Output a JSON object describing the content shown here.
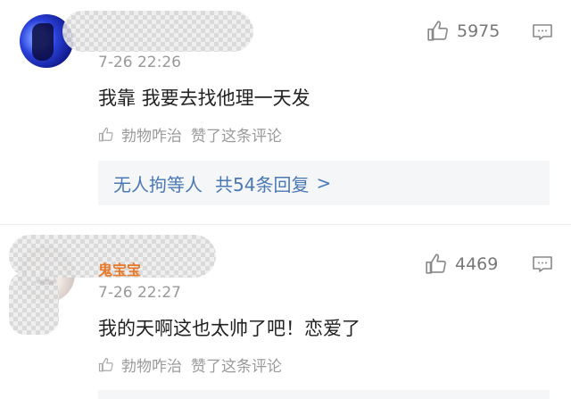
{
  "comments": [
    {
      "username": "",
      "time": "7-26 22:26",
      "text": "我靠 我要去找他理一天发",
      "likes": "5975",
      "author_like": {
        "name": "勃物咋治",
        "text": "赞了这条评论"
      },
      "replies": {
        "author": "无人拘等人",
        "count_text": "共54条回复",
        "chevron": ">"
      }
    },
    {
      "username": "鬼宝宝",
      "time": "7-26 22:27",
      "text": "我的天啊这也太帅了吧！恋爱了",
      "likes": "4469",
      "author_like": {
        "name": "勃物咋治",
        "text": "赞了这条评论"
      }
    }
  ],
  "icons": {
    "like": "thumbs-up-icon",
    "reply": "comment-icon"
  },
  "colors": {
    "link": "#4a78b5",
    "muted": "#999999",
    "username_accent": "#e87a2a"
  }
}
